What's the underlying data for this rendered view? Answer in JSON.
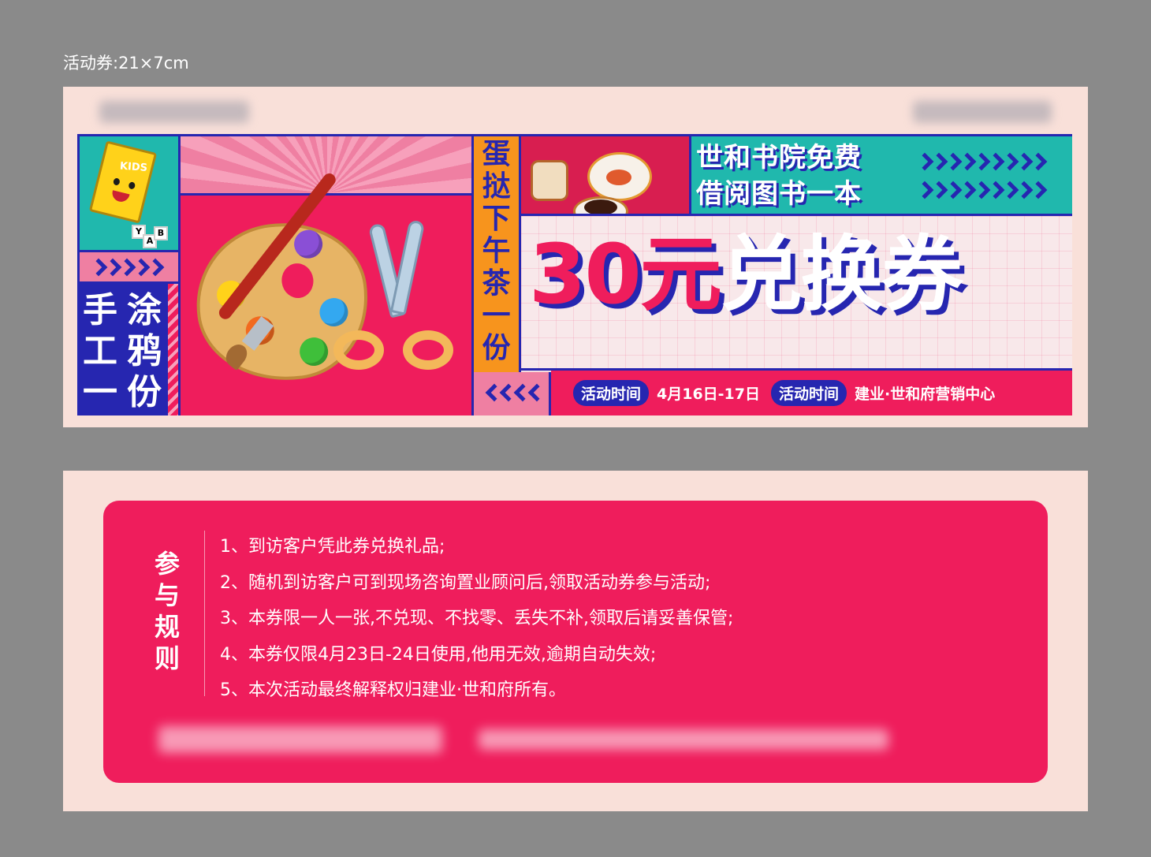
{
  "size_label": "活动券:21×7cm",
  "front": {
    "book_cover_text": "KIDS",
    "cube_letters": [
      "Y",
      "A",
      "B"
    ],
    "craft_col_1": [
      "手",
      "工",
      "一"
    ],
    "craft_col_2": [
      "涂",
      "鸦",
      "份"
    ],
    "cake_text": [
      "蛋",
      "挞",
      "下",
      "午",
      "茶",
      "一",
      "份"
    ],
    "promo_line_1": "世和书院免费",
    "promo_line_2": "借阅图书一本",
    "main_title_amount": "30元",
    "main_title_word": "兑换券",
    "time_label": "活动时间",
    "time_value": "4月16日-17日",
    "location_label": "活动时间",
    "location_value": "建业·世和府营销中心"
  },
  "back": {
    "rules_title_chars": [
      "参",
      "与",
      "规",
      "则"
    ],
    "rules": [
      "1、到访客户凭此券兑换礼品;",
      "2、随机到访客户可到现场咨询置业顾问后,领取活动券参与活动;",
      "3、本券限一人一张,不兑现、不找零、丢失不补,领取后请妥善保管;",
      "4、本券仅限4月23日-24日使用,他用无效,逾期自动失效;",
      "5、本次活动最终解释权归建业·世和府所有。"
    ]
  },
  "colors": {
    "magenta": "#ef1d5c",
    "navy": "#2626b0",
    "teal": "#20b8ad",
    "orange": "#f7941d",
    "pink": "#ef7fa2",
    "cream": "#f9e0d9",
    "background_gray": "#8a8a8a"
  },
  "icons": [
    "book-mascot-icon",
    "letter-cubes-icon",
    "paint-palette-icon",
    "paintbrush-icon",
    "scissors-icon",
    "sugar-jar-icon",
    "teapot-icon",
    "coffee-cup-icon",
    "chevron-right-icon",
    "chevron-left-icon"
  ]
}
